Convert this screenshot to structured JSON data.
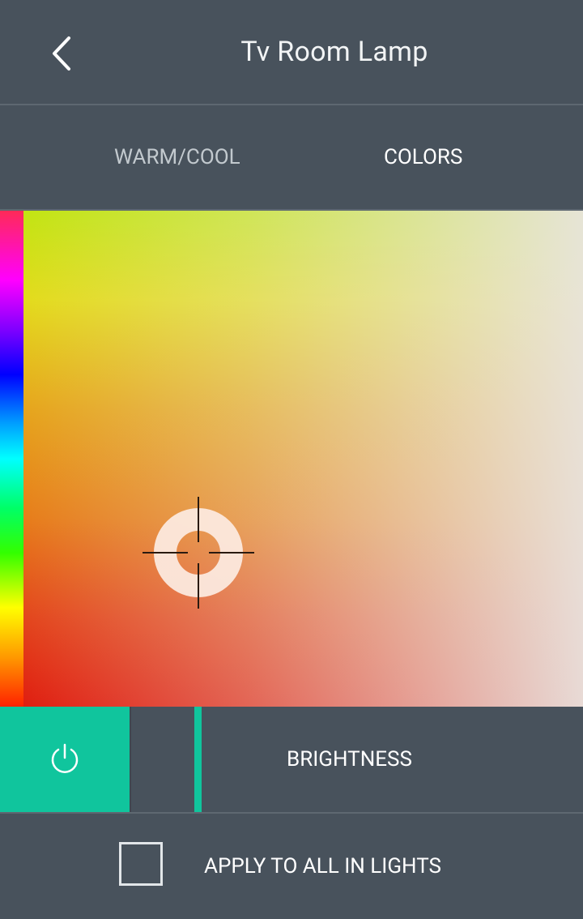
{
  "header": {
    "title": "Tv Room Lamp",
    "back_icon": "chevron-left-icon"
  },
  "tabs": [
    {
      "label": "WARM/COOL",
      "active": false
    },
    {
      "label": "COLORS",
      "active": true
    }
  ],
  "picker": {
    "hue_strip": "hue-spectrum",
    "crosshair_icon": "crosshair-ring-icon"
  },
  "controls": {
    "power_icon": "power-icon",
    "brightness_label": "BRIGHTNESS",
    "accent_color": "#10c59d"
  },
  "apply": {
    "label": "APPLY TO ALL IN LIGHTS",
    "checked": false
  }
}
